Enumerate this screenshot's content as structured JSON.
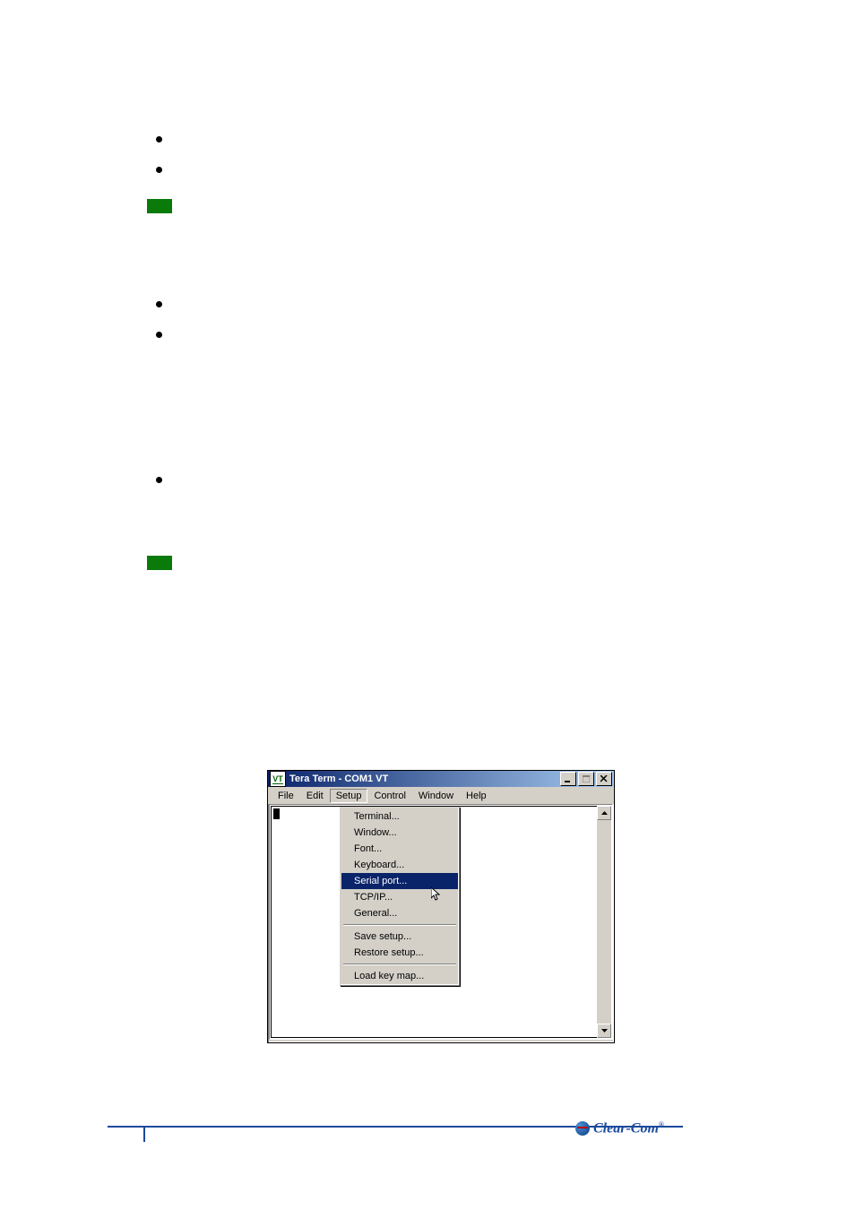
{
  "window": {
    "title": "Tera Term - COM1 VT",
    "icon_label": "VT"
  },
  "menubar": {
    "file": "File",
    "edit": "Edit",
    "setup": "Setup",
    "control": "Control",
    "window": "Window",
    "help": "Help"
  },
  "setup_menu": {
    "terminal": "Terminal...",
    "window": "Window...",
    "font": "Font...",
    "keyboard": "Keyboard...",
    "serial_port": "Serial port...",
    "tcp_ip": "TCP/IP...",
    "general": "General...",
    "save_setup": "Save setup...",
    "restore_setup": "Restore setup...",
    "load_key_map": "Load key map..."
  },
  "footer": {
    "brand": "Clear-Com"
  }
}
